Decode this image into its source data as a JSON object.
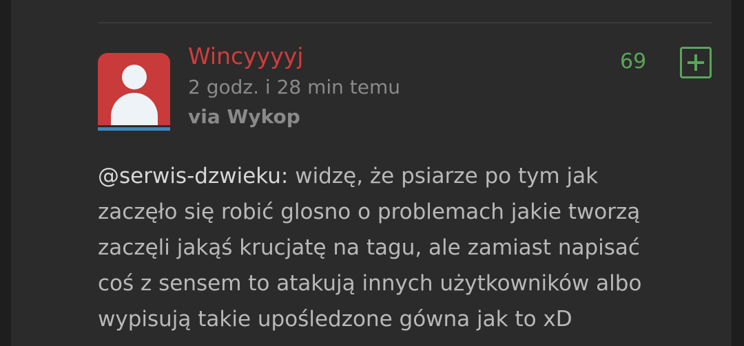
{
  "comment": {
    "author": "Wincyyyyj",
    "timestamp": "2 godz. i 28 min temu",
    "via": "via Wykop",
    "votes": "69",
    "mention": "@serwis-dzwieku:",
    "lines": [
      " widzę, że psiarze po tym jak",
      "zaczęło się robić glosno o problemach jakie tworzą",
      "zaczęli jakąś krucjatę na tagu, ale zamiast napisać",
      "coś z sensem to atakują innych użytkowników albo",
      "wypisują takie upośledzone gówna jak to xD"
    ]
  },
  "colors": {
    "author": "#d23c3c",
    "votes": "#5aa55a",
    "avatar_bg": "#c93a3a",
    "avatar_underline": "#3e86c0"
  },
  "icons": {
    "avatar": "default-user-avatar",
    "plus": "plus-square-icon"
  }
}
